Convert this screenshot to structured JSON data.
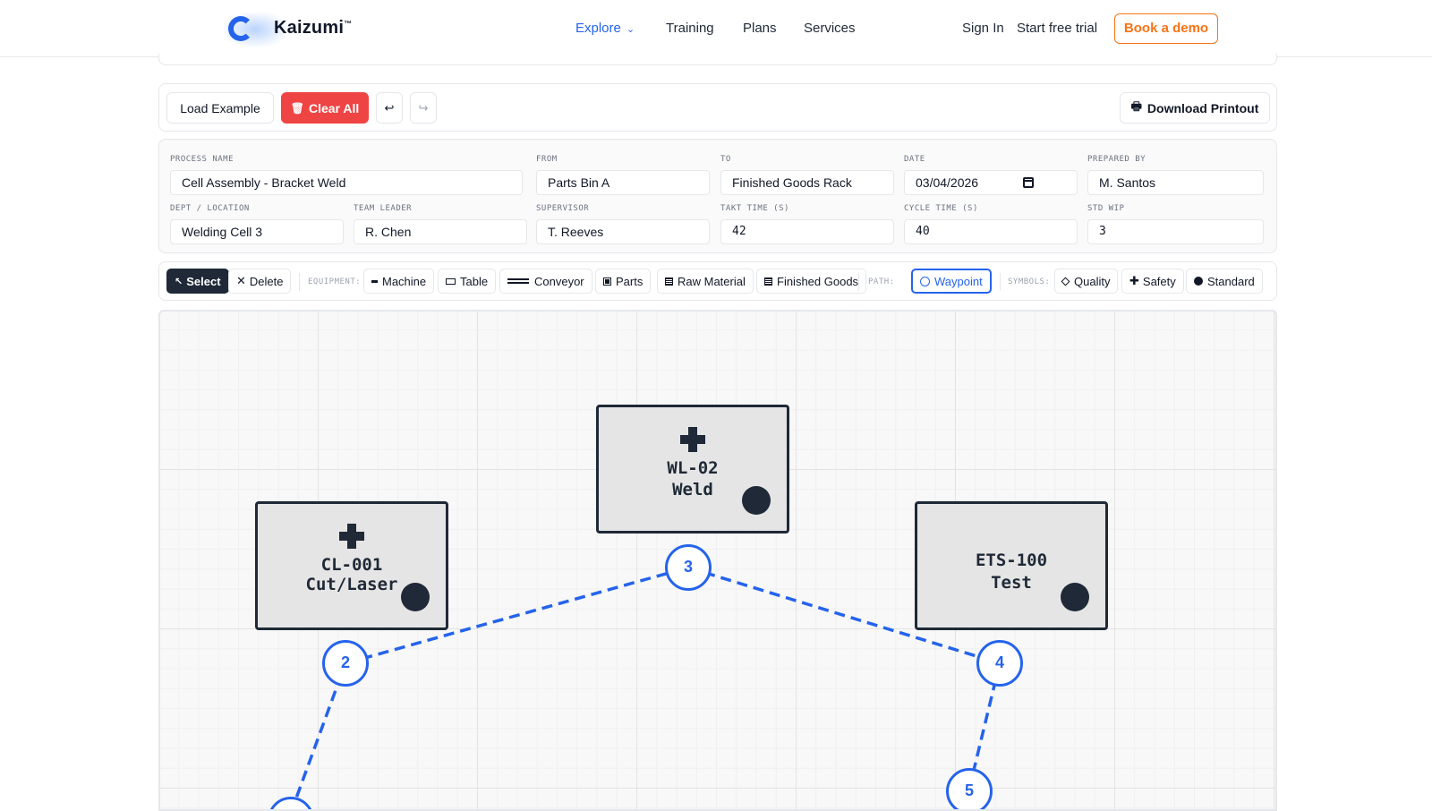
{
  "header": {
    "brand": "Kaizumi",
    "brand_tm": "™",
    "nav": {
      "explore": "Explore",
      "training": "Training",
      "plans": "Plans",
      "services": "Services",
      "sign_in": "Sign In",
      "free_trial": "Start free trial",
      "book_demo": "Book a demo"
    },
    "accent_color": "#2563eb",
    "cta_color": "#f97316"
  },
  "toolbar": {
    "load_example": "Load Example",
    "clear_all": "Clear All",
    "undo_glyph": "↩",
    "redo_glyph": "↪",
    "download": "Download Printout",
    "clear_color": "#ef4444"
  },
  "form": {
    "process_name": {
      "label": "PROCESS NAME",
      "value": "Cell Assembly - Bracket Weld"
    },
    "from": {
      "label": "FROM",
      "value": "Parts Bin A"
    },
    "to": {
      "label": "TO",
      "value": "Finished Goods Rack"
    },
    "date": {
      "label": "DATE",
      "value": "03/04/2026"
    },
    "prepared_by": {
      "label": "PREPARED BY",
      "value": "M. Santos"
    },
    "dept_location": {
      "label": "DEPT / LOCATION",
      "value": "Welding Cell 3"
    },
    "team_leader": {
      "label": "TEAM LEADER",
      "value": "R. Chen"
    },
    "supervisor": {
      "label": "SUPERVISOR",
      "value": "T. Reeves"
    },
    "takt_time": {
      "label": "TAKT TIME (S)",
      "value": "42"
    },
    "cycle_time": {
      "label": "CYCLE TIME (S)",
      "value": "40"
    },
    "std_wip": {
      "label": "STD WIP",
      "value": "3"
    }
  },
  "palette": {
    "select": "Select",
    "delete": "Delete",
    "equipment_label": "EQUIPMENT:",
    "machine": "Machine",
    "table": "Table",
    "conveyor": "Conveyor",
    "parts": "Parts",
    "raw_material": "Raw Material",
    "finished_goods": "Finished Goods",
    "path_label": "PATH:",
    "waypoint": "Waypoint",
    "symbols_label": "SYMBOLS:",
    "quality": "Quality",
    "safety": "Safety",
    "standard": "Standard"
  },
  "canvas": {
    "machines": [
      {
        "id": "CL-001",
        "name": "Cut/Laser",
        "safety": true,
        "standard": true
      },
      {
        "id": "WL-02",
        "name": "Weld",
        "safety": true,
        "standard": true
      },
      {
        "id": "ETS-100",
        "name": "Test",
        "safety": false,
        "standard": true
      }
    ],
    "waypoints": [
      "2",
      "3",
      "4",
      "5"
    ],
    "path_color": "#2563eb"
  }
}
